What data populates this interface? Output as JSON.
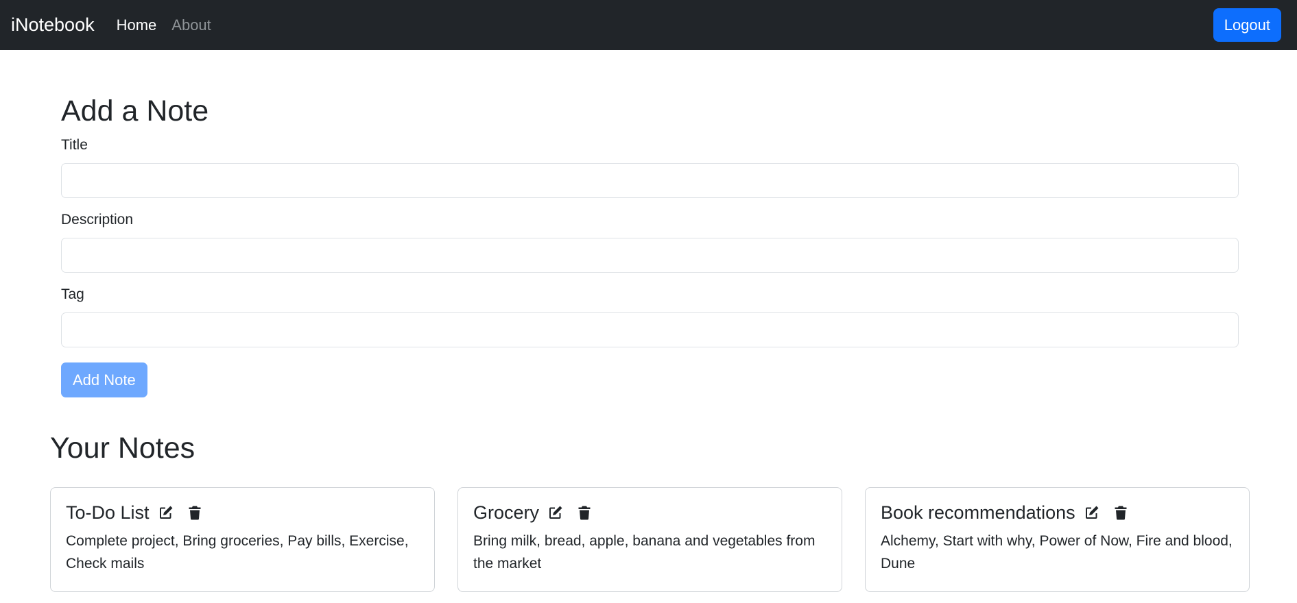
{
  "navbar": {
    "brand": "iNotebook",
    "links": [
      {
        "label": "Home",
        "active": true
      },
      {
        "label": "About",
        "active": false
      }
    ],
    "logout_label": "Logout"
  },
  "form": {
    "heading": "Add a Note",
    "fields": {
      "title": {
        "label": "Title",
        "value": ""
      },
      "description": {
        "label": "Description",
        "value": ""
      },
      "tag": {
        "label": "Tag",
        "value": ""
      }
    },
    "submit_label": "Add Note"
  },
  "notes": {
    "heading": "Your Notes",
    "items": [
      {
        "title": "To-Do List",
        "description": "Complete project, Bring groceries, Pay bills, Exercise, Check mails"
      },
      {
        "title": "Grocery",
        "description": "Bring milk, bread, apple, banana and vegetables from the market"
      },
      {
        "title": "Book recommendations",
        "description": "Alchemy, Start with why, Power of Now, Fire and blood, Dune"
      }
    ],
    "icons": {
      "edit": "edit-icon",
      "delete": "trash-icon"
    }
  },
  "colors": {
    "navbar_bg": "#212529",
    "primary": "#0d6efd",
    "primary_disabled": "#6ea8fe"
  }
}
